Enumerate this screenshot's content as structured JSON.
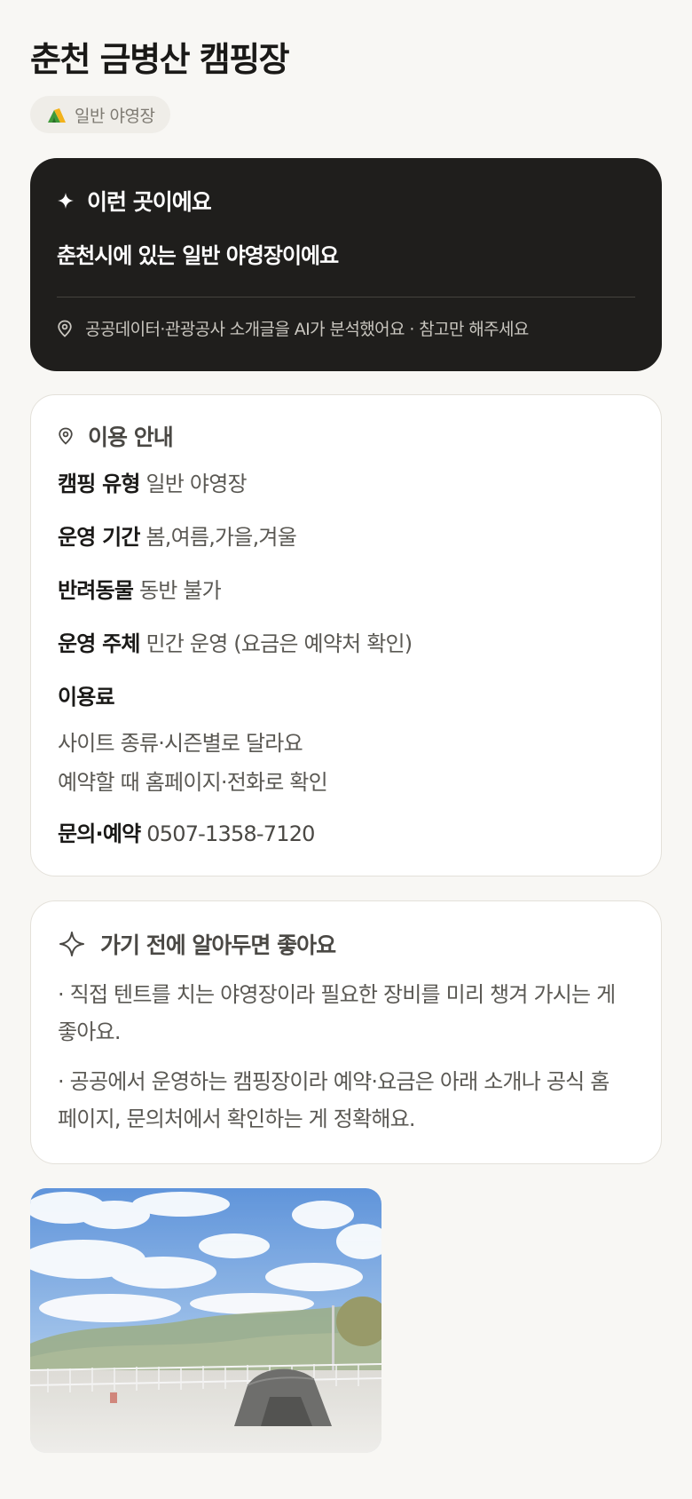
{
  "header": {
    "title": "춘천 금병산 캠핑장",
    "chip_label": "일반 야영장",
    "chip_icon": "tent-icon"
  },
  "summary_card": {
    "icon": "sparkle-icon",
    "heading": "이런 곳이에요",
    "body": "춘천시에 있는 일반 야영장이에요",
    "footnote_icon": "location-pin-icon",
    "footnote": "공공데이터·관광공사 소개글을 AI가 분석했어요 · 참고만 해주세요"
  },
  "info_card": {
    "icon": "location-pin-icon",
    "heading": "이용 안내",
    "rows": [
      {
        "key": "캠핑 유형",
        "value": "일반 야영장"
      },
      {
        "key": "운영 기간",
        "value": "봄,여름,가을,겨울"
      },
      {
        "key": "반려동물",
        "value": "동반 불가"
      },
      {
        "key": "운영 주체",
        "value": "민간 운영 (요금은 예약처 확인)"
      }
    ],
    "fee_label": "이용료",
    "fee_lines": [
      "사이트 종류·시즌별로 달라요",
      "예약할 때 홈페이지·전화로 확인"
    ],
    "contact_key": "문의·예약",
    "contact_value": "0507-1358-7120"
  },
  "tips_card": {
    "icon": "sparkle-outline-icon",
    "heading": "가기 전에 알아두면 좋아요",
    "tips": [
      "· 직접 텐트를 치는 야영장이라 필요한 장비를 미리 챙겨 가시는 게 좋아요.",
      "· 공공에서 운영하는 캠핑장이라 예약·요금은 아래 소개나 공식 홈페이지, 문의처에서 확인하는 게 정확해요."
    ]
  },
  "colors": {
    "background": "#f8f7f4",
    "dark_card": "#1f1e1c",
    "card_border": "#e4e1da",
    "text_primary": "#1a1917",
    "text_secondary": "#5a5853"
  }
}
